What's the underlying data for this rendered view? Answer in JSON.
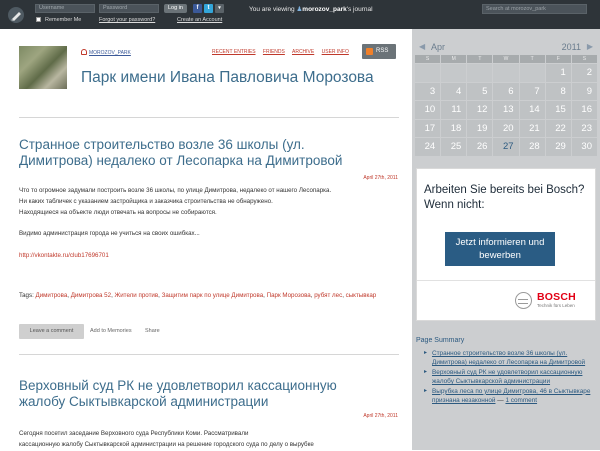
{
  "topbar": {
    "username_placeholder": "Username",
    "password_placeholder": "Password",
    "login_label": "Log in",
    "remember_me": "Remember Me",
    "forgot_password": "Forgot your password?",
    "create_account": "Create an Account",
    "facebook": "f",
    "twitter": "t",
    "viewing_prefix": "You are viewing",
    "viewing_user": "morozov_park",
    "viewing_suffix": "'s journal",
    "search_placeholder": "Search at morozov_park"
  },
  "journal": {
    "username": "MOROZOV_PARK",
    "title": "Парк имени Ивана Павловича Морозова",
    "nav": [
      "RECENT ENTRIES",
      "FRIENDS",
      "ARCHIVE",
      "USER INFO"
    ],
    "rss": "RSS"
  },
  "entries": [
    {
      "title": "Странное строительство возле 36 школы (ул. Димитрова) недалеко от Лесопарка на Димитровой",
      "date": "April 27th, 2011",
      "body": [
        "Что то огромное задумали построить возле 36 школы, по улице Димитрова, недалеко от нашего Лесопарка.",
        "Ни каких табличек с указанием застройщика и заказчика строительства не обнаружено.",
        "Находящиеся на объекте люди отвечать на вопросы не собираются.",
        "",
        "Видимо администрация города не учиться на своих ошибках...",
        "",
        "http://vkontakte.ru/club17696701"
      ],
      "tags_label": "Tags:",
      "tags": [
        "Димитрова",
        "Димитрова 52",
        "Жители против",
        "Защитим парк по улице Димитрова",
        "Парк Морозова",
        "рубят лес",
        "сыктывкар"
      ],
      "leave_comment": "Leave a comment",
      "add_memories": "Add to Memories",
      "share": "Share"
    },
    {
      "title": "Верховный суд РК не удовлетворил кассационную жалобу Сыктывкарской администрации",
      "date": "April 27th, 2011",
      "body": [
        "Сегодня посетил заседание Верховного суда Республики Коми. Рассматривали",
        "кассационную жалобу Сыктывкарской администрации на решение городского суда по делу о вырубке"
      ]
    }
  ],
  "calendar": {
    "month": "Apr",
    "year": "2011",
    "prev": "◀",
    "next": "▶",
    "dow": [
      "S",
      "M",
      "T",
      "W",
      "T",
      "F",
      "S"
    ],
    "weeks": [
      [
        "",
        "",
        "",
        "",
        "",
        "1",
        "2"
      ],
      [
        "3",
        "4",
        "5",
        "6",
        "7",
        "8",
        "9"
      ],
      [
        "10",
        "11",
        "12",
        "13",
        "14",
        "15",
        "16"
      ],
      [
        "17",
        "18",
        "19",
        "20",
        "21",
        "22",
        "23"
      ],
      [
        "24",
        "25",
        "26",
        "27",
        "28",
        "29",
        "30"
      ]
    ],
    "linked_day": "27"
  },
  "ad": {
    "text": "Arbeiten Sie bereits bei Bosch? Wenn nicht:",
    "button": "Jetzt informieren und bewerben",
    "brand": "BOSCH",
    "tagline": "Technik fürs Leben"
  },
  "summary": {
    "title": "Page Summary",
    "items": [
      {
        "link": "Странное строительство возле 36 школы (ул. Димитрова) недалеко от Лесопарка на Димитровой",
        "suffix": ""
      },
      {
        "link": "Верховный суд РК не удовлетворил кассационную жалобу Сыктывкарской администрации",
        "suffix": ""
      },
      {
        "link": "Вырубка леса по улице Димитрова, 46 в Сыктывкаре признана незаконной",
        "suffix": " — ",
        "extra": "1 comment"
      }
    ]
  },
  "colors": {
    "topbar_bg": "#2e3439",
    "sidebar_bg": "#ccced0",
    "title_blue": "#3d6d8c",
    "link_red": "#c0392b",
    "ad_button": "#2a5c84",
    "bosch_red": "#e20015"
  }
}
